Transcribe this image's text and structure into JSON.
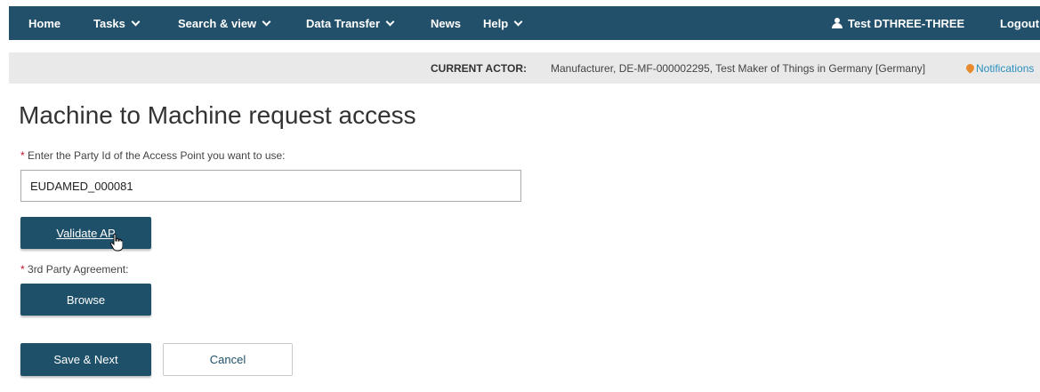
{
  "nav": {
    "items": [
      {
        "label": "Home",
        "dropdown": false
      },
      {
        "label": "Tasks",
        "dropdown": true
      },
      {
        "label": "Search & view",
        "dropdown": true
      },
      {
        "label": "Data Transfer",
        "dropdown": true
      },
      {
        "label": "News",
        "dropdown": false
      },
      {
        "label": "Help",
        "dropdown": true
      }
    ],
    "user_name": "Test DTHREE-THREE",
    "logout_label": "Logout"
  },
  "actor": {
    "label": "CURRENT ACTOR:",
    "value": "Manufacturer, DE-MF-000002295, Test Maker of Things in Germany [Germany]",
    "notifications_label": "Notifications"
  },
  "page": {
    "title": "Machine to Machine request access",
    "required_marker": "*",
    "party_id_label": "Enter the Party Id of the Access Point you want to use:",
    "party_id_value": "EUDAMED_000081",
    "validate_label": "Validate AP",
    "agreement_label": "3rd Party Agreement:",
    "browse_label": "Browse",
    "save_next_label": "Save & Next",
    "cancel_label": "Cancel"
  },
  "colors": {
    "navbar": "#224f69",
    "primary_button": "#1f5069",
    "actor_bar": "#e9e9e9",
    "required": "#c8102e",
    "link": "#2a8fbd",
    "notification_icon": "#e58a2e"
  }
}
